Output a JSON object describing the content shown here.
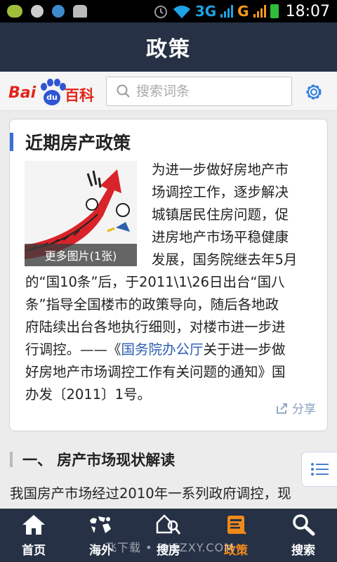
{
  "status_bar": {
    "icons": [
      "wechat-icon",
      "notification-icon",
      "globe-icon",
      "android-icon",
      "alarm-icon",
      "wifi-icon"
    ],
    "network_1": "3G",
    "network_2": "G",
    "time": "18:07"
  },
  "header": {
    "title": "政策"
  },
  "search": {
    "logo_text_left": "Bai",
    "logo_paw_text": "du",
    "logo_text_right": "百科",
    "placeholder": "搜索词条"
  },
  "card": {
    "title": "近期房产政策",
    "image_caption": "更多图片(1张)",
    "lines": [
      "为进一步做好房地产市",
      "场调控工作，逐步解决",
      "城镇居民住房问题，促",
      "进房地产市场平稳健康",
      "发展，国务院继去年5月",
      "的“国10条”后，于2011\\1\\26日出台“国八",
      "条”指导全国楼市的政策导向，随后各地政",
      "府陆续出台各地执行细则，对楼市进一步进",
      "行调控。——《",
      "国务院办公厅",
      "关于进一步做",
      "好房地产市场调控工作有关问题的通知》国",
      "办发〔2011〕1号。"
    ],
    "share_label": "分享"
  },
  "section": {
    "heading": "一、  房产市场现状解读",
    "first_line": "我国房产市场经过2010年一系列政府调控，现"
  },
  "bottom_nav": {
    "items": [
      {
        "label": "首页",
        "icon": "home-icon"
      },
      {
        "label": "海外",
        "icon": "world-map-icon"
      },
      {
        "label": "搜房",
        "icon": "house-search-icon"
      },
      {
        "label": "政策",
        "icon": "policy-document-icon"
      },
      {
        "label": "搜索",
        "icon": "search-icon"
      }
    ],
    "active": "政策",
    "active_color": "#f08a1a"
  },
  "watermark": "飞下载 • PYEZXY.COM",
  "colors": {
    "header_bg": "#263145",
    "link": "#2a5db0",
    "accent_bar": "#3b6fd8"
  }
}
